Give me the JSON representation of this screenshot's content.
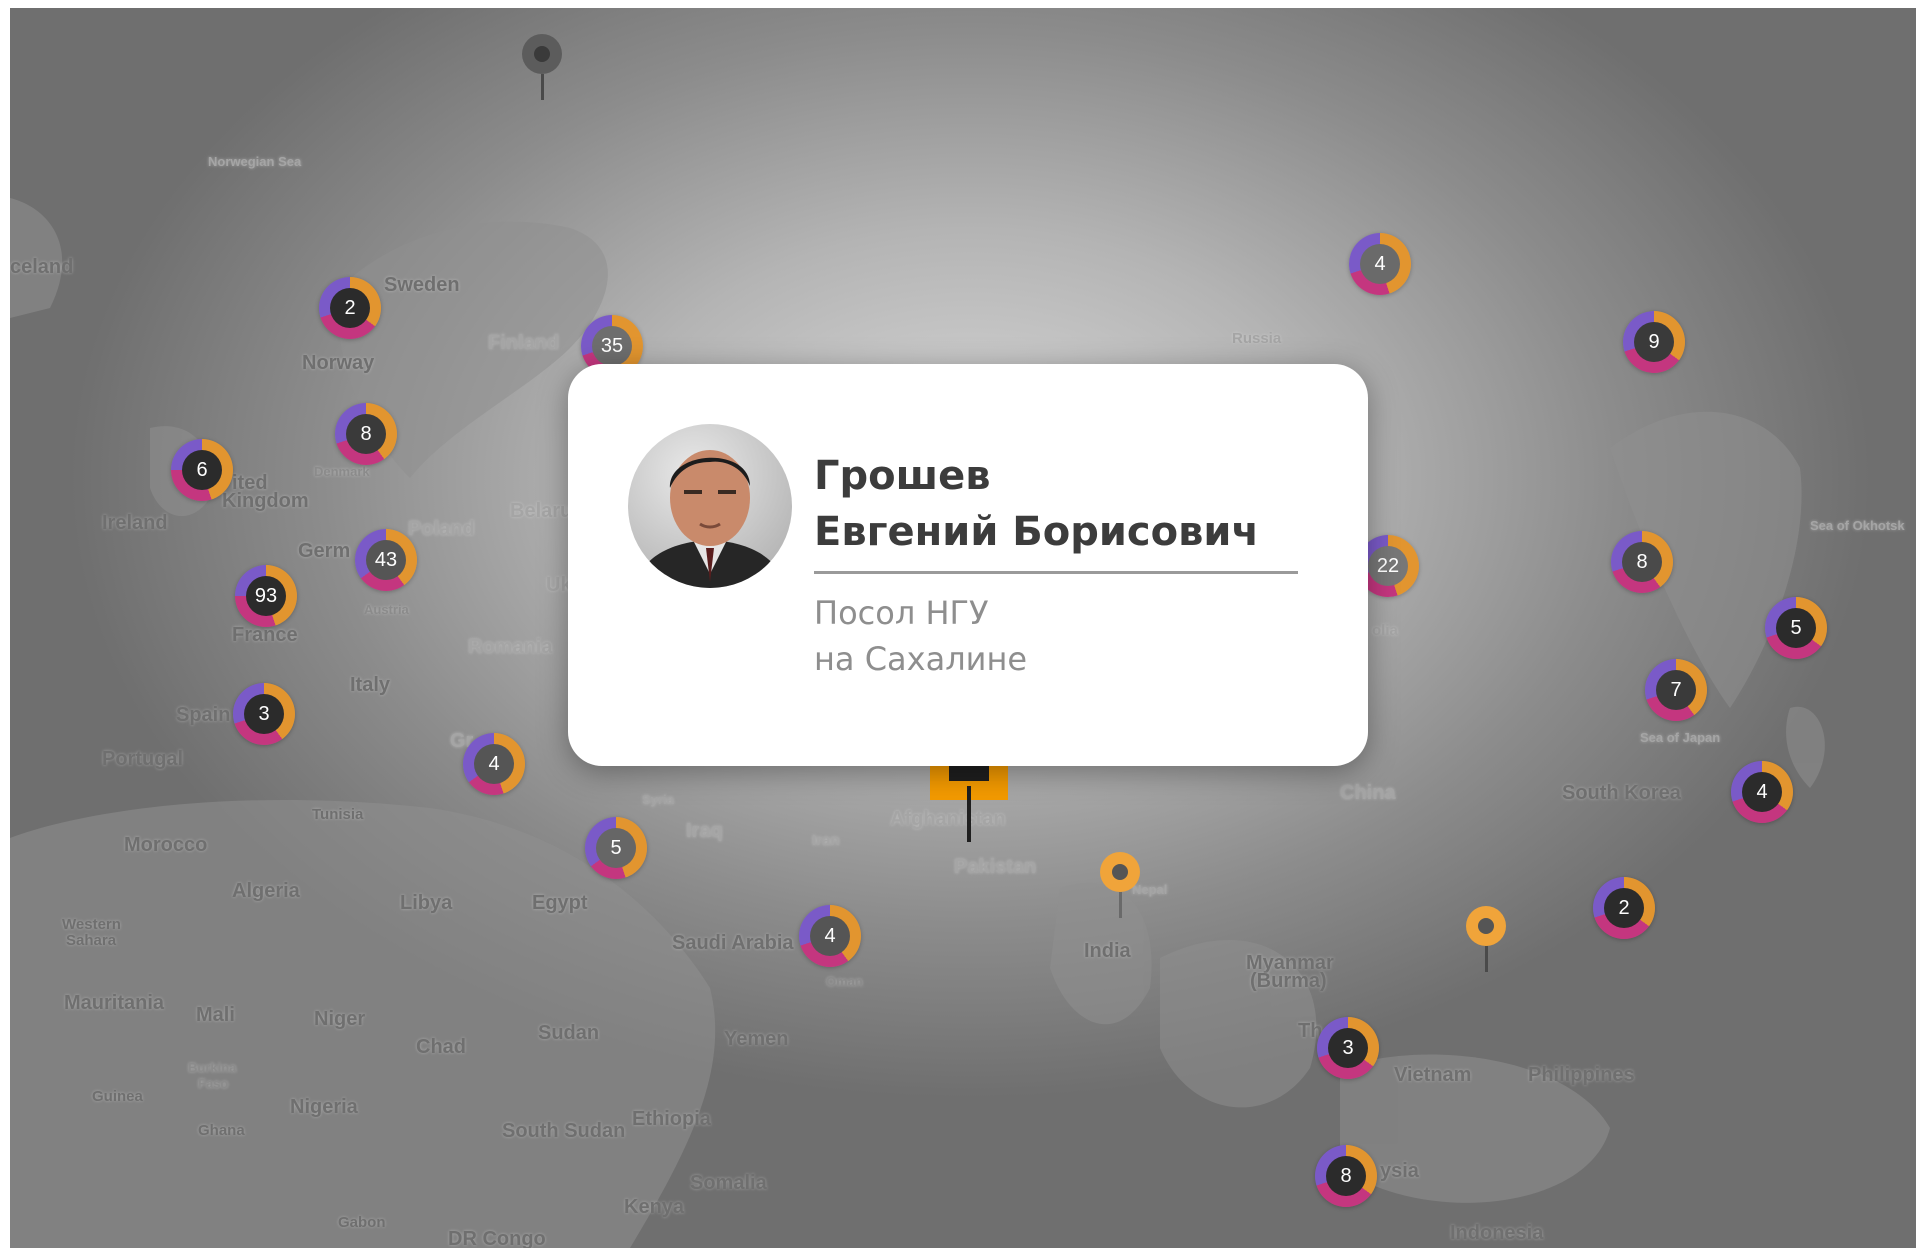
{
  "colors": {
    "accent": "#f39a00",
    "ring_orange": "#e2952f",
    "ring_magenta": "#c4367f",
    "ring_purple": "#7a5ac8",
    "cluster_center": "#2b2b2b",
    "pin_orange": "#f0a43a",
    "pin_grey": "#5c5c5c"
  },
  "map": {
    "places": [
      {
        "name": "Iceland",
        "text": "celand"
      },
      {
        "name": "Norwegian Sea",
        "text": "Norwegian Sea"
      },
      {
        "name": "Sweden",
        "text": "Sweden"
      },
      {
        "name": "Finland",
        "text": "Finland"
      },
      {
        "name": "Norway",
        "text": "Norway"
      },
      {
        "name": "Russia",
        "text": "Russia"
      },
      {
        "name": "Denmark",
        "text": "Denmark"
      },
      {
        "name": "United Kingdom 1",
        "text": "ited"
      },
      {
        "name": "United Kingdom 2",
        "text": "Kingdom"
      },
      {
        "name": "Ireland",
        "text": "Ireland"
      },
      {
        "name": "Belarus",
        "text": "Belaru"
      },
      {
        "name": "Poland",
        "text": "Poland"
      },
      {
        "name": "Germany",
        "text": "Germ"
      },
      {
        "name": "Ukraine",
        "text": "Ukr"
      },
      {
        "name": "Austria",
        "text": "Austria"
      },
      {
        "name": "France",
        "text": "France"
      },
      {
        "name": "Romania",
        "text": "Romania"
      },
      {
        "name": "Italy",
        "text": "Italy"
      },
      {
        "name": "Spain",
        "text": "Spain"
      },
      {
        "name": "Portugal",
        "text": "Portugal"
      },
      {
        "name": "Greece",
        "text": "Gr"
      },
      {
        "name": "Tunisia",
        "text": "Tunisia"
      },
      {
        "name": "Morocco",
        "text": "Morocco"
      },
      {
        "name": "Syria",
        "text": "Syria"
      },
      {
        "name": "Iraq",
        "text": "Iraq"
      },
      {
        "name": "Iran",
        "text": "Iran"
      },
      {
        "name": "Afghanistan",
        "text": "Afghanistan"
      },
      {
        "name": "Pakistan",
        "text": "Pakistan"
      },
      {
        "name": "Nepal",
        "text": "Nepal"
      },
      {
        "name": "China",
        "text": "China"
      },
      {
        "name": "Mongolia",
        "text": "olia"
      },
      {
        "name": "South Korea",
        "text": "South Korea"
      },
      {
        "name": "Sea of Japan",
        "text": "Sea of Japan"
      },
      {
        "name": "Sea of Okhotsk",
        "text": "Sea of Okhotsk"
      },
      {
        "name": "Algeria",
        "text": "Algeria"
      },
      {
        "name": "Libya",
        "text": "Libya"
      },
      {
        "name": "Egypt",
        "text": "Egypt"
      },
      {
        "name": "Saudi Arabia",
        "text": "Saudi Arabia"
      },
      {
        "name": "Oman",
        "text": "Oman"
      },
      {
        "name": "India",
        "text": "India"
      },
      {
        "name": "Myanmar 1",
        "text": "Myanmar"
      },
      {
        "name": "Myanmar 2",
        "text": "(Burma)"
      },
      {
        "name": "Western Sahara 1",
        "text": "Western"
      },
      {
        "name": "Western Sahara 2",
        "text": "Sahara"
      },
      {
        "name": "Mauritania",
        "text": "Mauritania"
      },
      {
        "name": "Mali",
        "text": "Mali"
      },
      {
        "name": "Niger",
        "text": "Niger"
      },
      {
        "name": "Chad",
        "text": "Chad"
      },
      {
        "name": "Sudan",
        "text": "Sudan"
      },
      {
        "name": "Yemen",
        "text": "Yemen"
      },
      {
        "name": "Thailand",
        "text": "Th"
      },
      {
        "name": "Vietnam",
        "text": "Vietnam"
      },
      {
        "name": "Philippines",
        "text": "Philippines"
      },
      {
        "name": "Burkina Faso 1",
        "text": "Burkina"
      },
      {
        "name": "Burkina Faso 2",
        "text": "Faso"
      },
      {
        "name": "Guinea",
        "text": "Guinea"
      },
      {
        "name": "Ghana",
        "text": "Ghana"
      },
      {
        "name": "Nigeria",
        "text": "Nigeria"
      },
      {
        "name": "South Sudan",
        "text": "South Sudan"
      },
      {
        "name": "Ethiopia",
        "text": "Ethiopia"
      },
      {
        "name": "Somalia",
        "text": "Somalia"
      },
      {
        "name": "Kenya",
        "text": "Kenya"
      },
      {
        "name": "Gabon",
        "text": "Gabon"
      },
      {
        "name": "DR Congo",
        "text": "DR Congo"
      },
      {
        "name": "Malaysia",
        "text": "ysia"
      },
      {
        "name": "Indonesia",
        "text": "Indonesia"
      }
    ],
    "clusters": [
      "2",
      "8",
      "6",
      "43",
      "93",
      "3",
      "4",
      "5",
      "4",
      "4",
      "9",
      "8",
      "5",
      "7",
      "4",
      "2",
      "3",
      "8",
      "35",
      "22"
    ],
    "pins": [
      "orange",
      "grey",
      "grey",
      "orange"
    ]
  },
  "popup": {
    "name_line1": "Грошев",
    "name_line2": "Евгений Борисович",
    "role_line1": "Посол НГУ",
    "role_line2": "на Сахалине"
  }
}
